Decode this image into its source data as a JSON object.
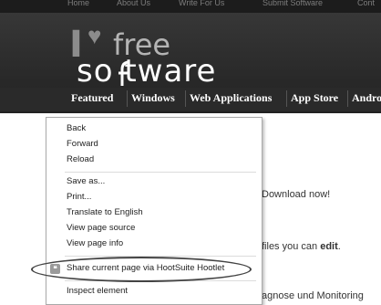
{
  "header": {
    "top_links": [
      "Home",
      "About Us",
      "Write For Us",
      "Submit Software",
      "Cont"
    ],
    "logo_free": "free",
    "logo_software": "so  tware",
    "nav": [
      "Featured",
      "Windows",
      "Web Applications",
      "App Store",
      "Andro"
    ]
  },
  "page": {
    "lines": [
      "Download now!",
      "files you can ",
      "edit",
      ".",
      "agnose und Monitoring"
    ]
  },
  "context_menu": {
    "items": [
      "Back",
      "Forward",
      "Reload",
      "Save as...",
      "Print...",
      "Translate to English",
      "View page source",
      "View page info",
      "Share current page via HootSuite Hootlet",
      "Inspect element"
    ],
    "extension_icon": "hootsuite-icon"
  }
}
